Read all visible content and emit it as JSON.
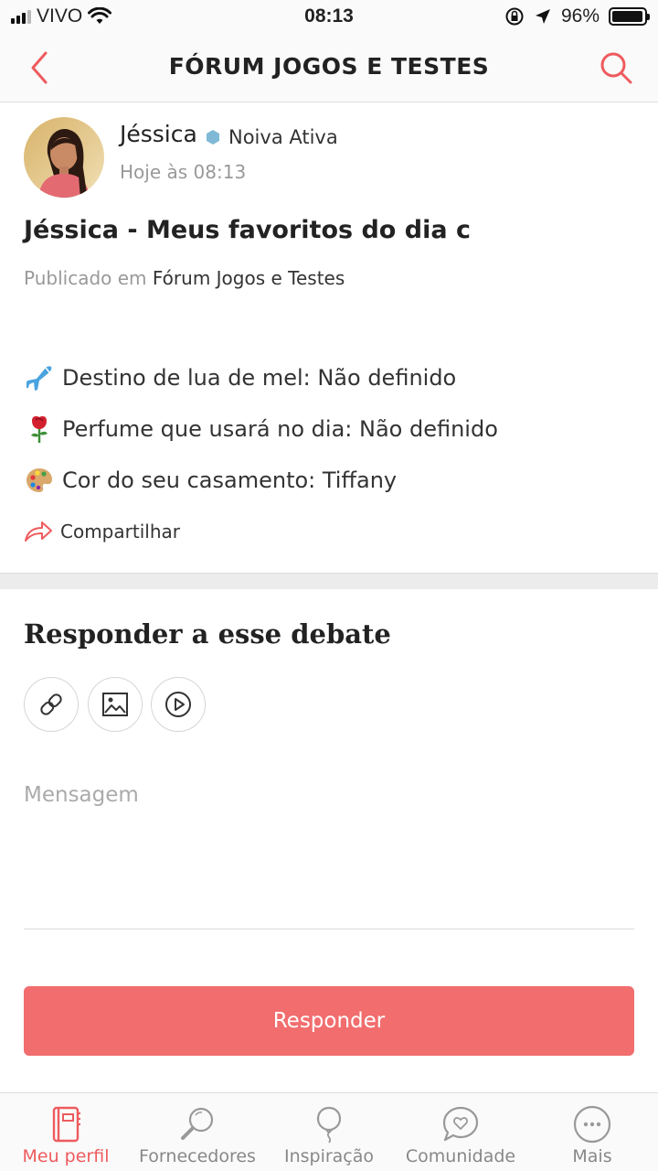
{
  "status_bar": {
    "carrier": "VIVO",
    "time": "08:13",
    "battery_percent": "96%",
    "battery_level": 0.96
  },
  "nav": {
    "title": "FÓRUM JOGOS E TESTES",
    "back_icon": "chevron-left-icon",
    "search_icon": "search-icon"
  },
  "post": {
    "author": "Jéssica",
    "badge": "Noiva Ativa",
    "time": "Hoje às 08:13",
    "title": "Jéssica - Meus favoritos do dia c",
    "published_prefix": "Publicado em",
    "published_forum": "Fórum Jogos e Testes",
    "lines": [
      {
        "emoji": "airplane",
        "text": "Destino de lua de mel: Não definido"
      },
      {
        "emoji": "rose",
        "text": "Perfume que usará no dia: Não definido"
      },
      {
        "emoji": "palette",
        "text": "Cor do seu casamento: Tiffany"
      }
    ],
    "share_label": "Compartilhar"
  },
  "reply": {
    "heading": "Responder a esse debate",
    "tools": [
      "link-icon",
      "image-icon",
      "video-icon"
    ],
    "message_placeholder": "Mensagem",
    "submit_label": "Responder"
  },
  "tabs": [
    {
      "label": "Meu perfil",
      "icon": "planner-icon",
      "active": true
    },
    {
      "label": "Fornecedores",
      "icon": "magnifier-icon",
      "active": false
    },
    {
      "label": "Inspiração",
      "icon": "balloon-icon",
      "active": false
    },
    {
      "label": "Comunidade",
      "icon": "chat-heart-icon",
      "active": false
    },
    {
      "label": "Mais",
      "icon": "more-icon",
      "active": false
    }
  ],
  "colors": {
    "accent": "#ee5b5e",
    "button": "#f26d6e",
    "badge": "#7fb9d6"
  }
}
